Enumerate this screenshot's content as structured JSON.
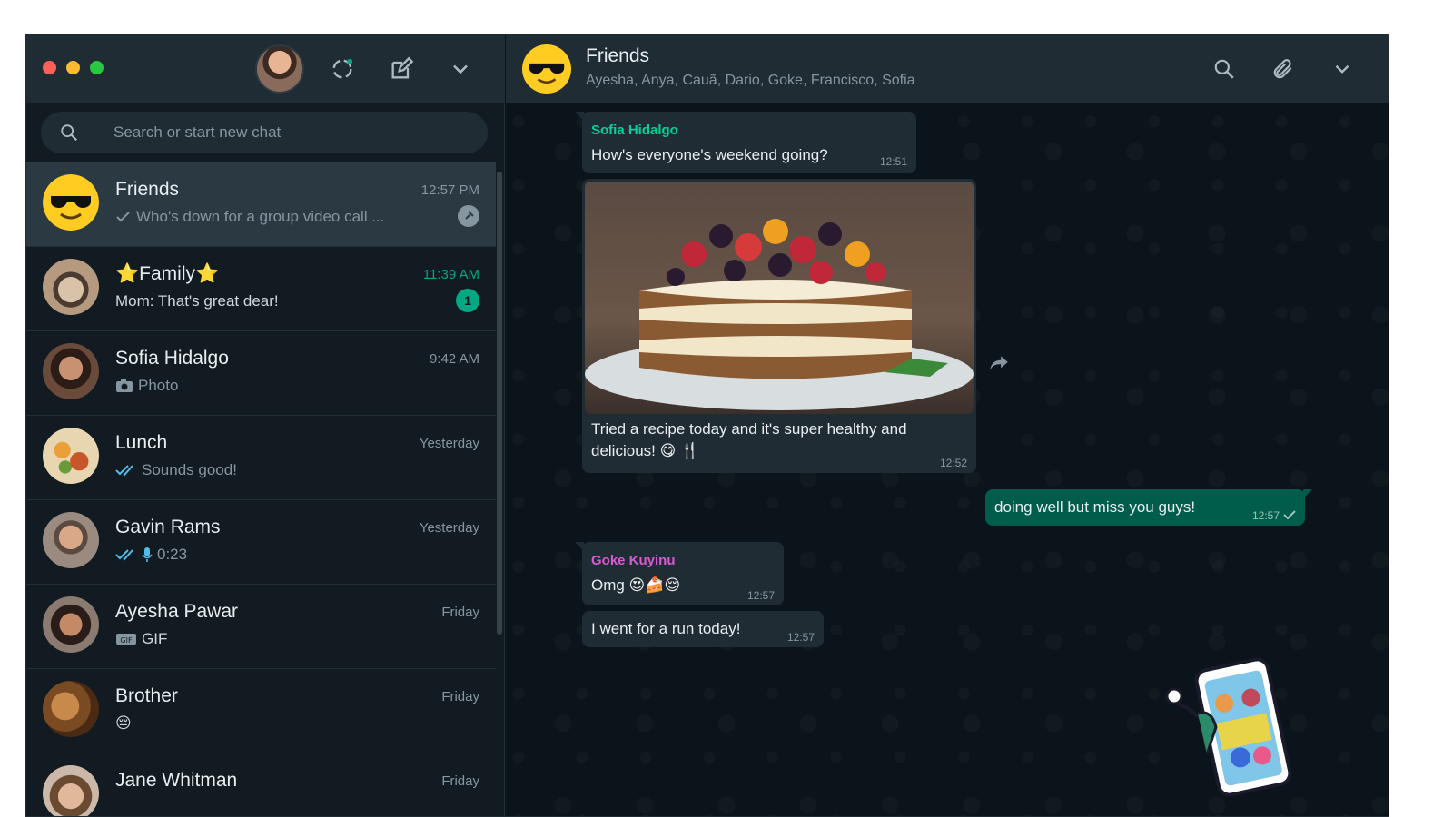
{
  "sidebar": {
    "search": {
      "placeholder": "Search or start new chat"
    },
    "header_icons": [
      "status-icon",
      "new-chat-icon",
      "menu-chevron-icon"
    ],
    "chats": [
      {
        "name": "Friends",
        "time": "12:57 PM",
        "preview": "Who's down for a group video call ...",
        "status": "sent-check",
        "active": true,
        "pinned": true
      },
      {
        "name": "⭐Family⭐",
        "time": "11:39 AM",
        "preview": "Mom: That's great dear!",
        "unread": "1"
      },
      {
        "name": "Sofia Hidalgo",
        "time": "9:42 AM",
        "preview": "Photo",
        "icon": "camera-icon"
      },
      {
        "name": "Lunch",
        "time": "Yesterday",
        "preview": "Sounds good!",
        "status": "read-double-check"
      },
      {
        "name": "Gavin Rams",
        "time": "Yesterday",
        "preview": "0:23",
        "status": "read-double-check",
        "icon": "mic-icon"
      },
      {
        "name": "Ayesha Pawar",
        "time": "Friday",
        "preview": "GIF",
        "icon": "gif-icon"
      },
      {
        "name": "Brother",
        "time": "Friday",
        "preview": "😔"
      },
      {
        "name": "Jane Whitman",
        "time": "Friday",
        "preview": ""
      }
    ]
  },
  "conversation": {
    "title": "Friends",
    "members": "Ayesha, Anya, Cauã, Dario, Goke, Francisco, Sofia",
    "header_icons": [
      "search-icon",
      "attach-icon",
      "menu-chevron-icon"
    ],
    "messages": [
      {
        "sender": "Sofia Hidalgo",
        "sender_color": "#06cf9c",
        "text": "How's everyone's weekend going?",
        "time": "12:51"
      },
      {
        "text_line1": "Tried a recipe today and it's super healthy and",
        "text_line2": "delicious! 😋 🍴",
        "time": "12:52"
      },
      {
        "text": "doing well but miss you guys!",
        "time": "12:57",
        "outgoing": true
      },
      {
        "sender": "Goke Kuyinu",
        "sender_color": "#d65bd1",
        "text": "Omg 😍🍰😌",
        "time": "12:57"
      },
      {
        "text": "I went for a run today!",
        "time": "12:57"
      }
    ]
  },
  "colors": {
    "accent": "#00a884",
    "panel": "#202c33",
    "background": "#0b141a",
    "outgoing": "#005c4b"
  }
}
